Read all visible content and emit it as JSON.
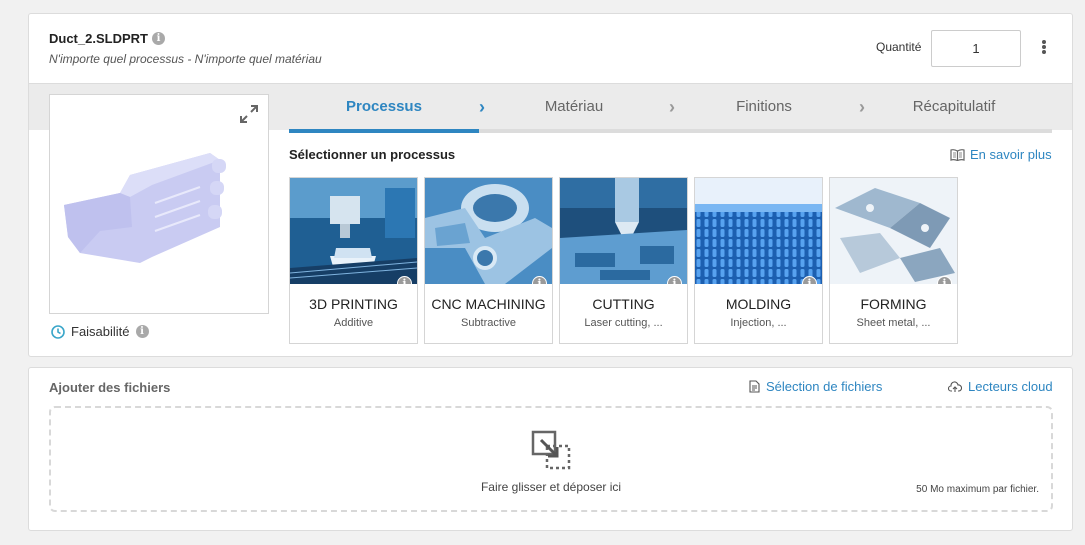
{
  "header": {
    "file_name": "Duct_2.SLDPRT",
    "subtitle": "N'importe quel processus - N'importe quel matériau",
    "quantity_label": "Quantité",
    "quantity_value": "1"
  },
  "steps": [
    {
      "label": "Processus",
      "active": true
    },
    {
      "label": "Matériau",
      "active": false
    },
    {
      "label": "Finitions",
      "active": false
    },
    {
      "label": "Récapitulatif",
      "active": false
    }
  ],
  "preview": {
    "feasibility_label": "Faisabilité"
  },
  "process": {
    "section_title": "Sélectionner un processus",
    "learn_more": "En savoir plus",
    "tiles": [
      {
        "name": "3D PRINTING",
        "sub": "Additive"
      },
      {
        "name": "CNC MACHINING",
        "sub": "Subtractive"
      },
      {
        "name": "CUTTING",
        "sub": "Laser cutting, ..."
      },
      {
        "name": "MOLDING",
        "sub": "Injection, ..."
      },
      {
        "name": "FORMING",
        "sub": "Sheet metal, ..."
      }
    ]
  },
  "files": {
    "title": "Ajouter des fichiers",
    "select_files": "Sélection de fichiers",
    "cloud_drives": "Lecteurs cloud",
    "drop_text": "Faire glisser et déposer ici",
    "limit_text": "50 Mo maximum par fichier."
  },
  "colors": {
    "accent": "#2e86c1",
    "step_band": "#ebebeb",
    "part_color": "#c9cbf2"
  }
}
